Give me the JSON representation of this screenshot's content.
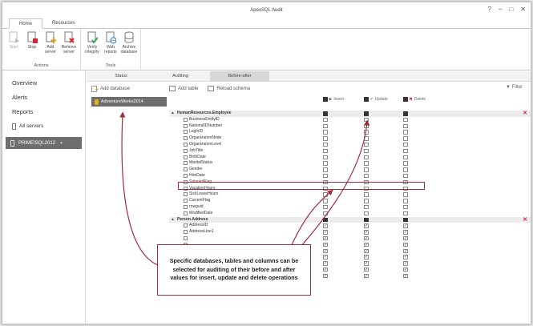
{
  "window": {
    "title": "ApexSQL Audit",
    "controls": [
      "?",
      "–",
      "□",
      "✕"
    ]
  },
  "ribbon": {
    "tabs": [
      {
        "label": "Home"
      },
      {
        "label": "Resources"
      }
    ],
    "groups": [
      {
        "label": "Actions",
        "buttons": [
          {
            "label": "Start",
            "icon": "play-icon",
            "disabled": true
          },
          {
            "label": "Stop",
            "icon": "stop-icon",
            "disabled": false
          },
          {
            "label": "Add server",
            "icon": "add-server-icon",
            "disabled": false
          },
          {
            "label": "Remove server",
            "icon": "remove-server-icon",
            "disabled": false
          }
        ]
      },
      {
        "label": "Tools",
        "buttons": [
          {
            "label": "Verify integrity",
            "icon": "verify-icon",
            "disabled": false
          },
          {
            "label": "Web reports",
            "icon": "web-reports-icon",
            "disabled": false
          },
          {
            "label": "Archive database",
            "icon": "archive-icon",
            "disabled": false
          }
        ]
      }
    ]
  },
  "sidebar": {
    "items": [
      {
        "label": "Overview"
      },
      {
        "label": "Alerts"
      },
      {
        "label": "Reports"
      }
    ],
    "all_servers": "All servers",
    "server": "PRIME\\SQL2012"
  },
  "subtabs": [
    {
      "label": "Status"
    },
    {
      "label": "Auditing"
    },
    {
      "label": "Before-after"
    }
  ],
  "db_pane": {
    "add_label": "Add database",
    "selected_db": "AdventureWorks2014"
  },
  "table_tools": {
    "add_table": "Add table",
    "reload_schema": "Reload schema",
    "filter": "Filter"
  },
  "columns": {
    "insert": "Insert",
    "update": "Update",
    "delete": "Delete"
  },
  "tables": [
    {
      "name": "HumanResources.Employee",
      "columns": [
        {
          "name": "BusinessEntityID",
          "i": false,
          "u": false,
          "d": false
        },
        {
          "name": "NationalIDNumber",
          "i": false,
          "u": false,
          "d": false
        },
        {
          "name": "LoginID",
          "i": false,
          "u": false,
          "d": false
        },
        {
          "name": "OrganizationNode",
          "i": false,
          "u": false,
          "d": false
        },
        {
          "name": "OrganizationLevel",
          "i": false,
          "u": false,
          "d": false
        },
        {
          "name": "JobTitle",
          "i": false,
          "u": false,
          "d": false
        },
        {
          "name": "BirthDate",
          "i": false,
          "u": false,
          "d": false
        },
        {
          "name": "MaritalStatus",
          "i": false,
          "u": false,
          "d": false
        },
        {
          "name": "Gender",
          "i": false,
          "u": false,
          "d": false
        },
        {
          "name": "HireDate",
          "i": false,
          "u": false,
          "d": false
        },
        {
          "name": "SalariedFlag",
          "i": true,
          "u": true,
          "d": true
        },
        {
          "name": "VacationHours",
          "i": false,
          "u": false,
          "d": false
        },
        {
          "name": "SickLeaveHours",
          "i": false,
          "u": false,
          "d": false
        },
        {
          "name": "CurrentFlag",
          "i": false,
          "u": false,
          "d": false
        },
        {
          "name": "rowguid",
          "i": false,
          "u": false,
          "d": false
        },
        {
          "name": "ModifiedDate",
          "i": false,
          "u": false,
          "d": false
        }
      ]
    },
    {
      "name": "Person.Address",
      "columns": [
        {
          "name": "AddressID",
          "i": true,
          "u": true,
          "d": true
        },
        {
          "name": "AddressLine1",
          "i": true,
          "u": true,
          "d": true
        },
        {
          "name": "",
          "i": true,
          "u": true,
          "d": true
        },
        {
          "name": "",
          "i": true,
          "u": true,
          "d": true
        },
        {
          "name": "",
          "i": true,
          "u": true,
          "d": true
        },
        {
          "name": "",
          "i": true,
          "u": true,
          "d": true
        },
        {
          "name": "",
          "i": true,
          "u": true,
          "d": true
        },
        {
          "name": "",
          "i": true,
          "u": true,
          "d": true
        },
        {
          "name": "",
          "i": true,
          "u": true,
          "d": true
        }
      ]
    }
  ],
  "callout": {
    "text": "Specific databases, tables and columns can be selected for auditing of their before and after values for insert, update and delete operations"
  },
  "colors": {
    "accent": "#a12b36",
    "delete": "#dd2233",
    "update": "#3aa34a"
  }
}
